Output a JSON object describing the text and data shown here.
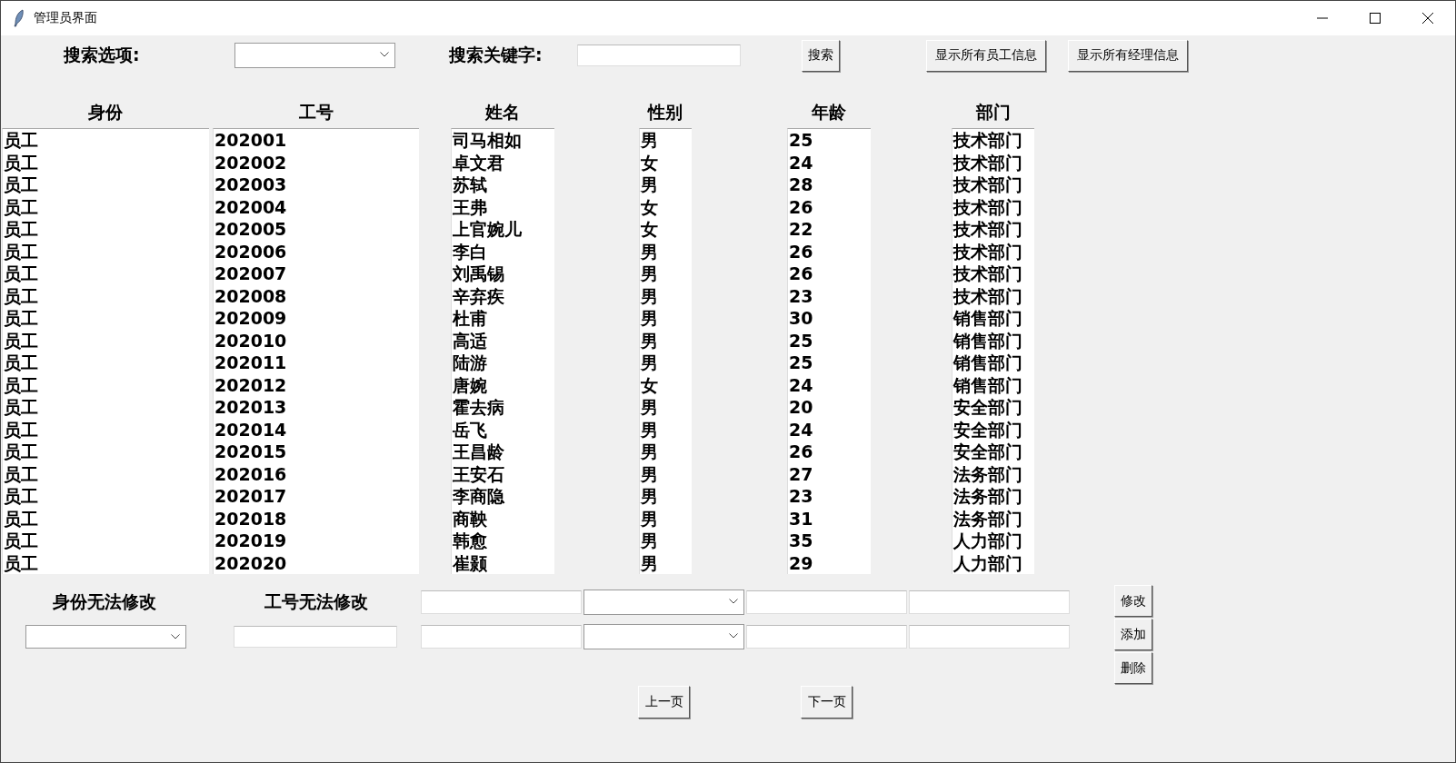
{
  "window": {
    "title": "管理员界面"
  },
  "search": {
    "option_label": "搜索选项:",
    "keyword_label": "搜索关键字:",
    "button": "搜索"
  },
  "show_buttons": [
    "显示所有员工信息",
    "显示所有经理信息"
  ],
  "columns": [
    {
      "header": "身份",
      "values": [
        "员工",
        "员工",
        "员工",
        "员工",
        "员工",
        "员工",
        "员工",
        "员工",
        "员工",
        "员工",
        "员工",
        "员工",
        "员工",
        "员工",
        "员工",
        "员工",
        "员工",
        "员工",
        "员工",
        "员工"
      ]
    },
    {
      "header": "工号",
      "values": [
        "202001",
        "202002",
        "202003",
        "202004",
        "202005",
        "202006",
        "202007",
        "202008",
        "202009",
        "202010",
        "202011",
        "202012",
        "202013",
        "202014",
        "202015",
        "202016",
        "202017",
        "202018",
        "202019",
        "202020"
      ]
    },
    {
      "header": "姓名",
      "values": [
        "司马相如",
        "卓文君",
        "苏轼",
        "王弗",
        "上官婉儿",
        "李白",
        "刘禹锡",
        "辛弃疾",
        "杜甫",
        "高适",
        "陆游",
        "唐婉",
        "霍去病",
        "岳飞",
        "王昌龄",
        "王安石",
        "李商隐",
        "商鞅",
        "韩愈",
        "崔颢"
      ]
    },
    {
      "header": "性别",
      "values": [
        "男",
        "女",
        "男",
        "女",
        "女",
        "男",
        "男",
        "男",
        "男",
        "男",
        "男",
        "女",
        "男",
        "男",
        "男",
        "男",
        "男",
        "男",
        "男",
        "男"
      ]
    },
    {
      "header": "年龄",
      "values": [
        "25",
        "24",
        "28",
        "26",
        "22",
        "26",
        "26",
        "23",
        "30",
        "25",
        "25",
        "24",
        "20",
        "24",
        "26",
        "27",
        "23",
        "31",
        "35",
        "29"
      ]
    },
    {
      "header": "部门",
      "values": [
        "技术部门",
        "技术部门",
        "技术部门",
        "技术部门",
        "技术部门",
        "技术部门",
        "技术部门",
        "技术部门",
        "销售部门",
        "销售部门",
        "销售部门",
        "销售部门",
        "安全部门",
        "安全部门",
        "安全部门",
        "法务部门",
        "法务部门",
        "法务部门",
        "人力部门",
        "人力部门"
      ]
    }
  ],
  "edit_form": {
    "labels": [
      "身份无法修改",
      "工号无法修改"
    ],
    "buttons": [
      "修改",
      "添加",
      "删除"
    ]
  },
  "pager": [
    "上一页",
    "下一页"
  ]
}
